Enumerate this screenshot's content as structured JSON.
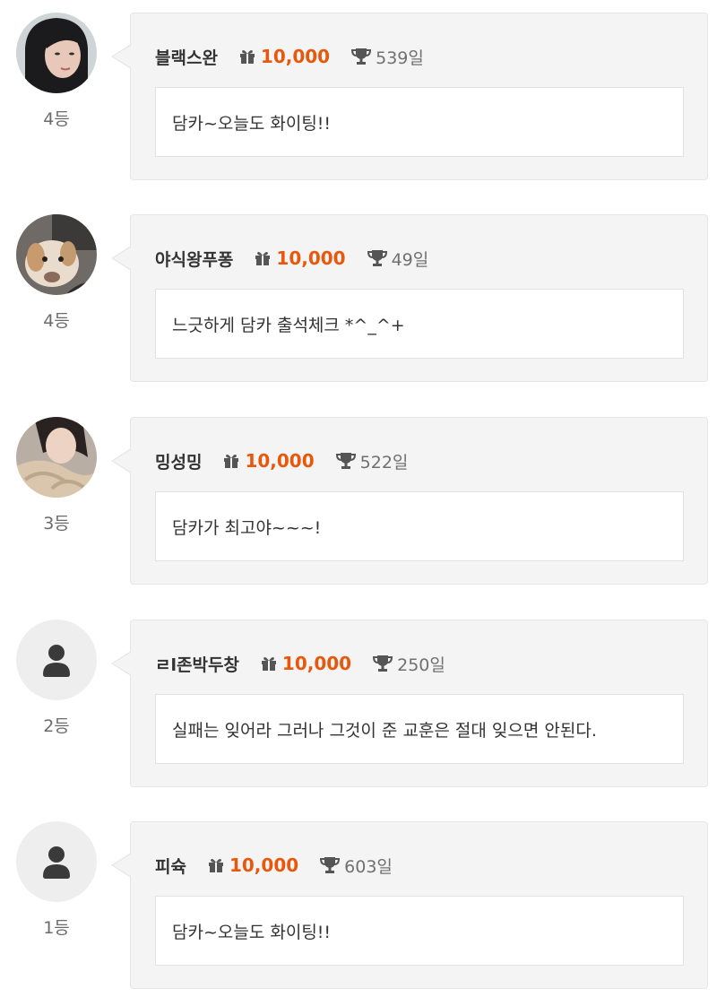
{
  "entries": [
    {
      "nickname": "블랙스완",
      "gift": "10,000",
      "days": "539일",
      "message": "담카~오늘도 화이팅!!",
      "rank": "4등",
      "avatar": "avatar-photo-woman-dark-hair"
    },
    {
      "nickname": "야식왕푸퐁",
      "gift": "10,000",
      "days": "49일",
      "message": "느긋하게 담카 출석체크 *^_^+",
      "rank": "4등",
      "avatar": "avatar-photo-dog"
    },
    {
      "nickname": "밍성밍",
      "gift": "10,000",
      "days": "522일",
      "message": "담카가 최고야~~~!",
      "rank": "3등",
      "avatar": "avatar-photo-woman-beige"
    },
    {
      "nickname": "ㄹl존박두창",
      "gift": "10,000",
      "days": "250일",
      "message": "실패는 잊어라 그러나 그것이 준 교훈은 절대 잊으면 안된다.",
      "rank": "2등",
      "avatar": "default-user-icon"
    },
    {
      "nickname": "피슉",
      "gift": "10,000",
      "days": "603일",
      "message": "담카~오늘도 화이팅!!",
      "rank": "1등",
      "avatar": "default-user-icon"
    }
  ],
  "colors": {
    "accent": "#e8580c",
    "bubble_bg": "#f4f4f4",
    "avatar_bg": "#eeeeee",
    "icon": "#555555"
  }
}
